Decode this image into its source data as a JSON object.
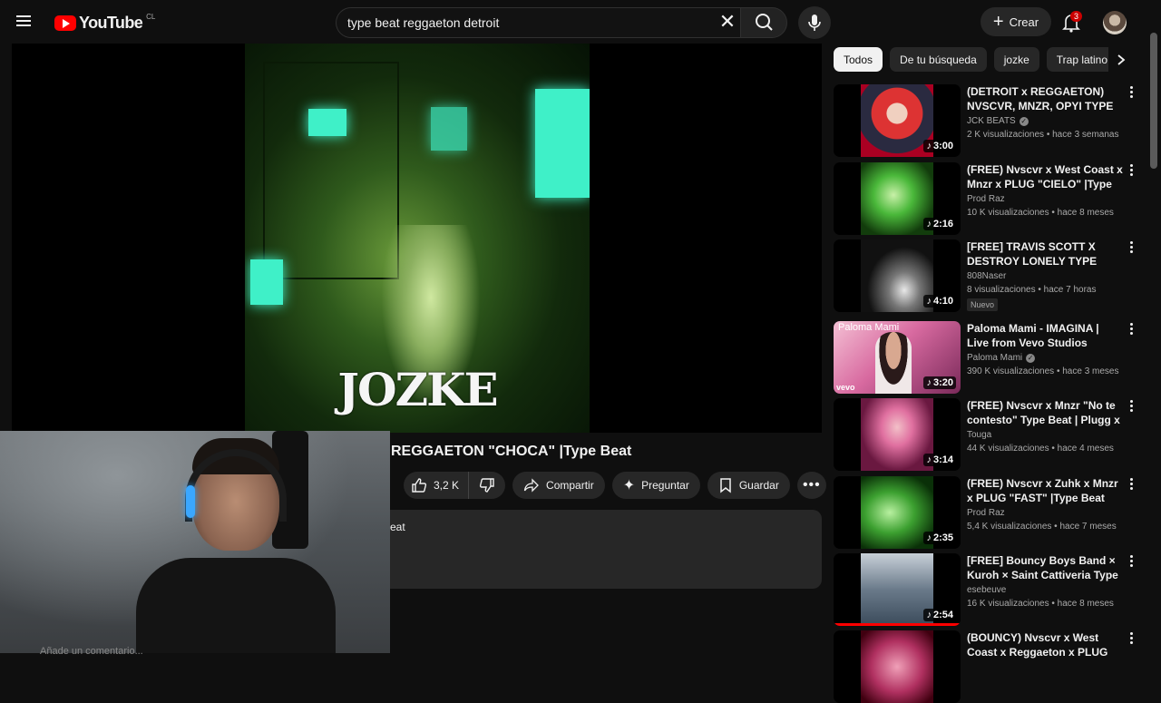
{
  "header": {
    "logo_text": "YouTube",
    "country_code": "CL",
    "search_value": "type beat reggaeton detroit",
    "create_label": "Crear",
    "notification_count": "3"
  },
  "player": {
    "artwork_text": "JOZKE"
  },
  "video": {
    "title": "REGGAETON \"CHOCA\" |Type Beat",
    "like_count": "3,2 K",
    "share_label": "Compartir",
    "ask_label": "Preguntar",
    "save_label": "Guardar",
    "description_snippet": "eat",
    "comment_hint": "Añade un comentario..."
  },
  "chips": [
    "Todos",
    "De tu búsqueda",
    "jozke",
    "Trap latino"
  ],
  "recommendations": [
    {
      "title": "(DETROIT x REGGAETON) NVSCVR, MNZR, OPYI TYPE ...",
      "channel": "JCK BEATS",
      "verified": true,
      "meta": "2 K visualizaciones • hace 3 semanas",
      "duration": "3:00",
      "badge": ""
    },
    {
      "title": "(FREE) Nvscvr x West Coast x Mnzr x PLUG \"CIELO\" |Type ...",
      "channel": "Prod Raz",
      "verified": false,
      "meta": "10 K visualizaciones • hace 8 meses",
      "duration": "2:16",
      "badge": ""
    },
    {
      "title": "[FREE] TRAVIS SCOTT X DESTROY LONELY TYPE BEAT...",
      "channel": "808Naser",
      "verified": false,
      "meta": "8 visualizaciones • hace 7 horas",
      "duration": "4:10",
      "badge": "Nuevo"
    },
    {
      "title": "Paloma Mami - IMAGINA | Live from Vevo Studios",
      "channel": "Paloma Mami",
      "verified": true,
      "meta": "390 K visualizaciones • hace 3 meses",
      "duration": "3:20",
      "badge": "",
      "thumb_label": "Paloma Mami",
      "thumb_brand": "vevo"
    },
    {
      "title": "(FREE) Nvscvr x Mnzr \"No te contesto\" Type Beat | Plugg x ...",
      "channel": "Touga",
      "verified": false,
      "meta": "44 K visualizaciones • hace 4 meses",
      "duration": "3:14",
      "badge": ""
    },
    {
      "title": "(FREE) Nvscvr x Zuhk x Mnzr x PLUG \"FAST\" |Type Beat (prod...",
      "channel": "Prod Raz",
      "verified": false,
      "meta": "5,4 K visualizaciones • hace 7 meses",
      "duration": "2:35",
      "badge": ""
    },
    {
      "title": "[FREE] Bouncy Boys Band × Kuroh × Saint Cattiveria Type ...",
      "channel": "esebeuve",
      "verified": false,
      "meta": "16 K visualizaciones • hace 8 meses",
      "duration": "2:54",
      "badge": "",
      "watched": 1.0
    },
    {
      "title": "(BOUNCY) Nvscvr x West Coast x Reggaeton x PLUG \"TE VEO...",
      "channel": "",
      "verified": false,
      "meta": "",
      "duration": "",
      "badge": ""
    }
  ],
  "colors": {
    "background": "#0f0f0f",
    "accent": "#ff0000",
    "chip_active": "#f1f1f1",
    "surface": "#272727"
  },
  "icons": [
    "menu-icon",
    "youtube-logo-icon",
    "clear-icon",
    "search-icon",
    "mic-icon",
    "plus-icon",
    "bell-icon",
    "like-icon",
    "dislike-icon",
    "share-icon",
    "sparkle-icon",
    "bookmark-icon",
    "more-icon",
    "chevron-right-icon",
    "music-note-icon",
    "verified-icon",
    "kebab-icon"
  ]
}
